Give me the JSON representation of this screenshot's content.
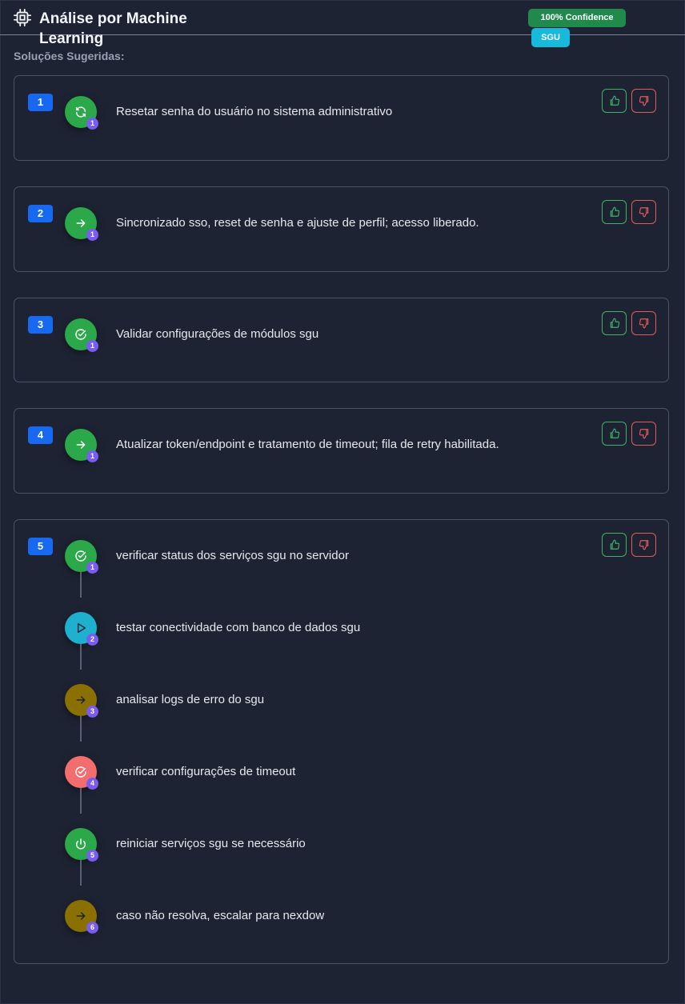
{
  "header": {
    "title": "Análise por Machine Learning",
    "confidence_badge": "100% Confidence",
    "system_badge": "SGU",
    "chip_icon": "cpu-chip-icon"
  },
  "section_label": "Soluções Sugeridas:",
  "colors": {
    "green": "#2aa84a",
    "cyan": "#1fb0d0",
    "olive": "#8a7000",
    "red": "#f26d6d",
    "badge_blue": "#1669f0",
    "sub_badge_purple": "#7a5cf0",
    "thumbs_up_border": "#3fb265",
    "thumbs_down_border": "#e15b5b"
  },
  "solutions": [
    {
      "number": "1",
      "steps": [
        {
          "num": "1",
          "text": "Resetar senha do usuário no sistema administrativo",
          "icon": "refresh-icon",
          "color": "green"
        }
      ]
    },
    {
      "number": "2",
      "steps": [
        {
          "num": "1",
          "text": "Sincronizado sso, reset de senha e ajuste de perfil; acesso liberado.",
          "icon": "arrow-right-icon",
          "color": "green"
        }
      ]
    },
    {
      "number": "3",
      "steps": [
        {
          "num": "1",
          "text": "Validar configurações de módulos sgu",
          "icon": "check-circle-icon",
          "color": "green"
        }
      ]
    },
    {
      "number": "4",
      "steps": [
        {
          "num": "1",
          "text": "Atualizar token/endpoint e tratamento de timeout; fila de retry habilitada.",
          "icon": "arrow-right-icon",
          "color": "green"
        }
      ]
    },
    {
      "number": "5",
      "steps": [
        {
          "num": "1",
          "text": "verificar status dos serviços sgu no servidor",
          "icon": "check-circle-icon",
          "color": "green"
        },
        {
          "num": "2",
          "text": "testar conectividade com banco de dados sgu",
          "icon": "play-icon",
          "color": "cyan"
        },
        {
          "num": "3",
          "text": "analisar logs de erro do sgu",
          "icon": "arrow-right-icon",
          "color": "olive"
        },
        {
          "num": "4",
          "text": "verificar configurações de timeout",
          "icon": "check-circle-icon",
          "color": "red"
        },
        {
          "num": "5",
          "text": "reiniciar serviços sgu se necessário",
          "icon": "power-icon",
          "color": "green"
        },
        {
          "num": "6",
          "text": "caso não resolva, escalar para nexdow",
          "icon": "arrow-right-icon",
          "color": "olive"
        }
      ]
    }
  ]
}
